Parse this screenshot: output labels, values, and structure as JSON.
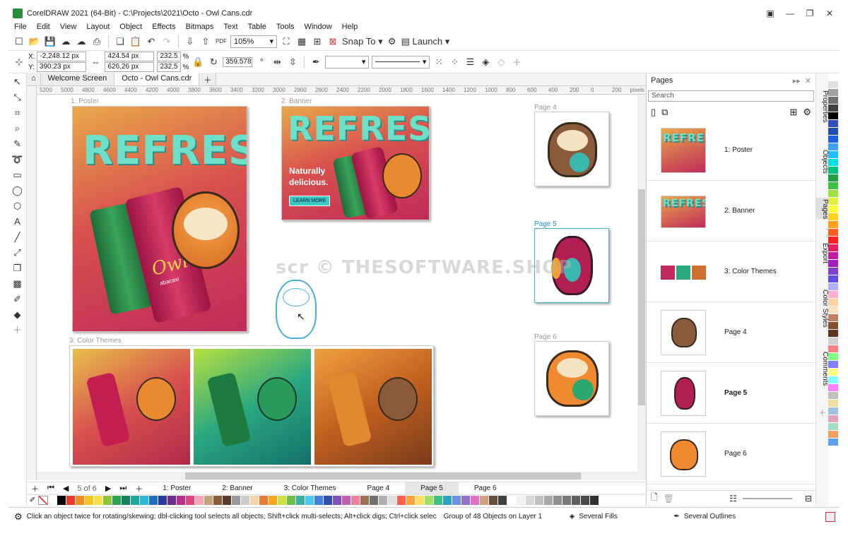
{
  "window": {
    "title": "CorelDRAW 2021 (64-Bit) - C:\\Projects\\2021\\Octo - Owl Cans.cdr"
  },
  "menu": [
    "File",
    "Edit",
    "View",
    "Layout",
    "Object",
    "Effects",
    "Bitmaps",
    "Text",
    "Table",
    "Tools",
    "Window",
    "Help"
  ],
  "toolbar": {
    "zoom": "105%",
    "snap_to": "Snap To",
    "launch": "Launch"
  },
  "propbar": {
    "x_label": "X:",
    "x": "-2,248.12 px",
    "y_label": "Y:",
    "y": "390.23 px",
    "w": "424.54 px",
    "h": "626.26 px",
    "sx": "232.5",
    "sy": "232.5",
    "pct": "%",
    "angle": "359.578"
  },
  "doc_tabs": [
    "Welcome Screen",
    "Octo - Owl Cans.cdr"
  ],
  "ruler": {
    "ticks": [
      "5200",
      "5000",
      "4800",
      "4600",
      "4400",
      "4200",
      "4000",
      "3800",
      "3600",
      "3400",
      "3200",
      "3000",
      "2800",
      "2600",
      "2400",
      "2200",
      "2000",
      "1800",
      "1600",
      "1400",
      "1200",
      "1000",
      "800",
      "600",
      "400",
      "200",
      "0",
      "200"
    ],
    "unit": "pixels"
  },
  "canvas": {
    "labels": {
      "p1": "1: Poster",
      "p2": "2: Banner",
      "p3": "3: Color Themes",
      "p4": "Page 4",
      "p5": "Page 5",
      "p6": "Page 6"
    },
    "headline": "REFRESH",
    "banner_line1": "Naturally",
    "banner_line2": "delicious.",
    "banner_button": "LEARN MORE",
    "can_script": "Owl",
    "can_sub": "abacaxi"
  },
  "watermark": "scr © THESOFTWARE.SHOP",
  "page_nav": {
    "counter": "5 of 6",
    "tabs": [
      "1: Poster",
      "2: Banner",
      "3: Color Themes",
      "Page 4",
      "Page 5",
      "Page 6"
    ],
    "selected": 4
  },
  "docker": {
    "title": "Pages",
    "search_placeholder": "Search",
    "pages": [
      {
        "name": "1: Poster",
        "bold": false
      },
      {
        "name": "2: Banner",
        "bold": false
      },
      {
        "name": "3: Color Themes",
        "bold": false
      },
      {
        "name": "Page 4",
        "bold": false
      },
      {
        "name": "Page 5",
        "bold": true
      },
      {
        "name": "Page 6",
        "bold": false
      }
    ]
  },
  "side_tabs": [
    "Properties",
    "Objects",
    "Pages",
    "Export",
    "Color Styles",
    "Comments"
  ],
  "status": {
    "hint": "Click an object twice for rotating/skewing; dbl-clicking tool selects all objects; Shift+click multi-selects; Alt+click digs; Ctrl+click selects in a group",
    "selection": "Group of 48 Objects on Layer 1",
    "fill": "Several Fills",
    "outline": "Several Outlines"
  },
  "palette_colors": [
    "#ffffff",
    "#000000",
    "#e83b2e",
    "#f48c1f",
    "#f7c520",
    "#f5e24a",
    "#8fc23f",
    "#2aa44a",
    "#15825a",
    "#1ba8a0",
    "#2fb7d8",
    "#1f6fc4",
    "#2a3a9a",
    "#6a2d91",
    "#b62f8a",
    "#e0457a",
    "#f4a6b6",
    "#c6a27a",
    "#8a5a3a",
    "#5a3a2a",
    "#999999",
    "#cccccc",
    "#f3d6a8",
    "#e87a3a",
    "#f5a623",
    "#d0e040",
    "#6ac04a",
    "#3ab0a0",
    "#50c8f0",
    "#4080e0",
    "#3050b0",
    "#8050c0",
    "#c060b0",
    "#f080a0",
    "#a07050",
    "#707070",
    "#b0b0b0",
    "#e0e0e0",
    "#ff6050",
    "#ffa040",
    "#ffe060",
    "#a0e060",
    "#40c080",
    "#30a0c0",
    "#7090e0",
    "#9070d0",
    "#e070c0",
    "#d0a080",
    "#605040",
    "#404040",
    "#ffffff",
    "#f0f0f0",
    "#d8d8d8",
    "#c0c0c0",
    "#a8a8a8",
    "#909090",
    "#787878",
    "#606060",
    "#484848",
    "#303030"
  ],
  "vpalette_colors": [
    "#ffffff",
    "#e0e0e0",
    "#a0a0a0",
    "#707070",
    "#404040",
    "#000000",
    "#3050c0",
    "#1f4fb0",
    "#2060e0",
    "#40a0ff",
    "#20c0ff",
    "#00e0e0",
    "#00c080",
    "#20a040",
    "#40c040",
    "#a0e040",
    "#e0f040",
    "#ffff40",
    "#ffd020",
    "#ffa020",
    "#ff6020",
    "#ff2020",
    "#e02060",
    "#c020a0",
    "#a020c0",
    "#8040d0",
    "#6050e0",
    "#b0b0ff",
    "#ffb0d0",
    "#ffd0a0",
    "#ffe0c0",
    "#c08060",
    "#805030",
    "#603020",
    "#d0d0d0",
    "#ff8080",
    "#80ff80",
    "#8080ff",
    "#ffff80",
    "#80ffff",
    "#ff80ff",
    "#c0c0c0",
    "#f0e0a0",
    "#a0c0e0",
    "#e0a0c0",
    "#a0e0c0",
    "#f0a060",
    "#60a0f0"
  ],
  "colors": {
    "accent": "#1aa0d8",
    "headline": "#6fe0c8",
    "poster_bottom": "#c02a5a"
  }
}
